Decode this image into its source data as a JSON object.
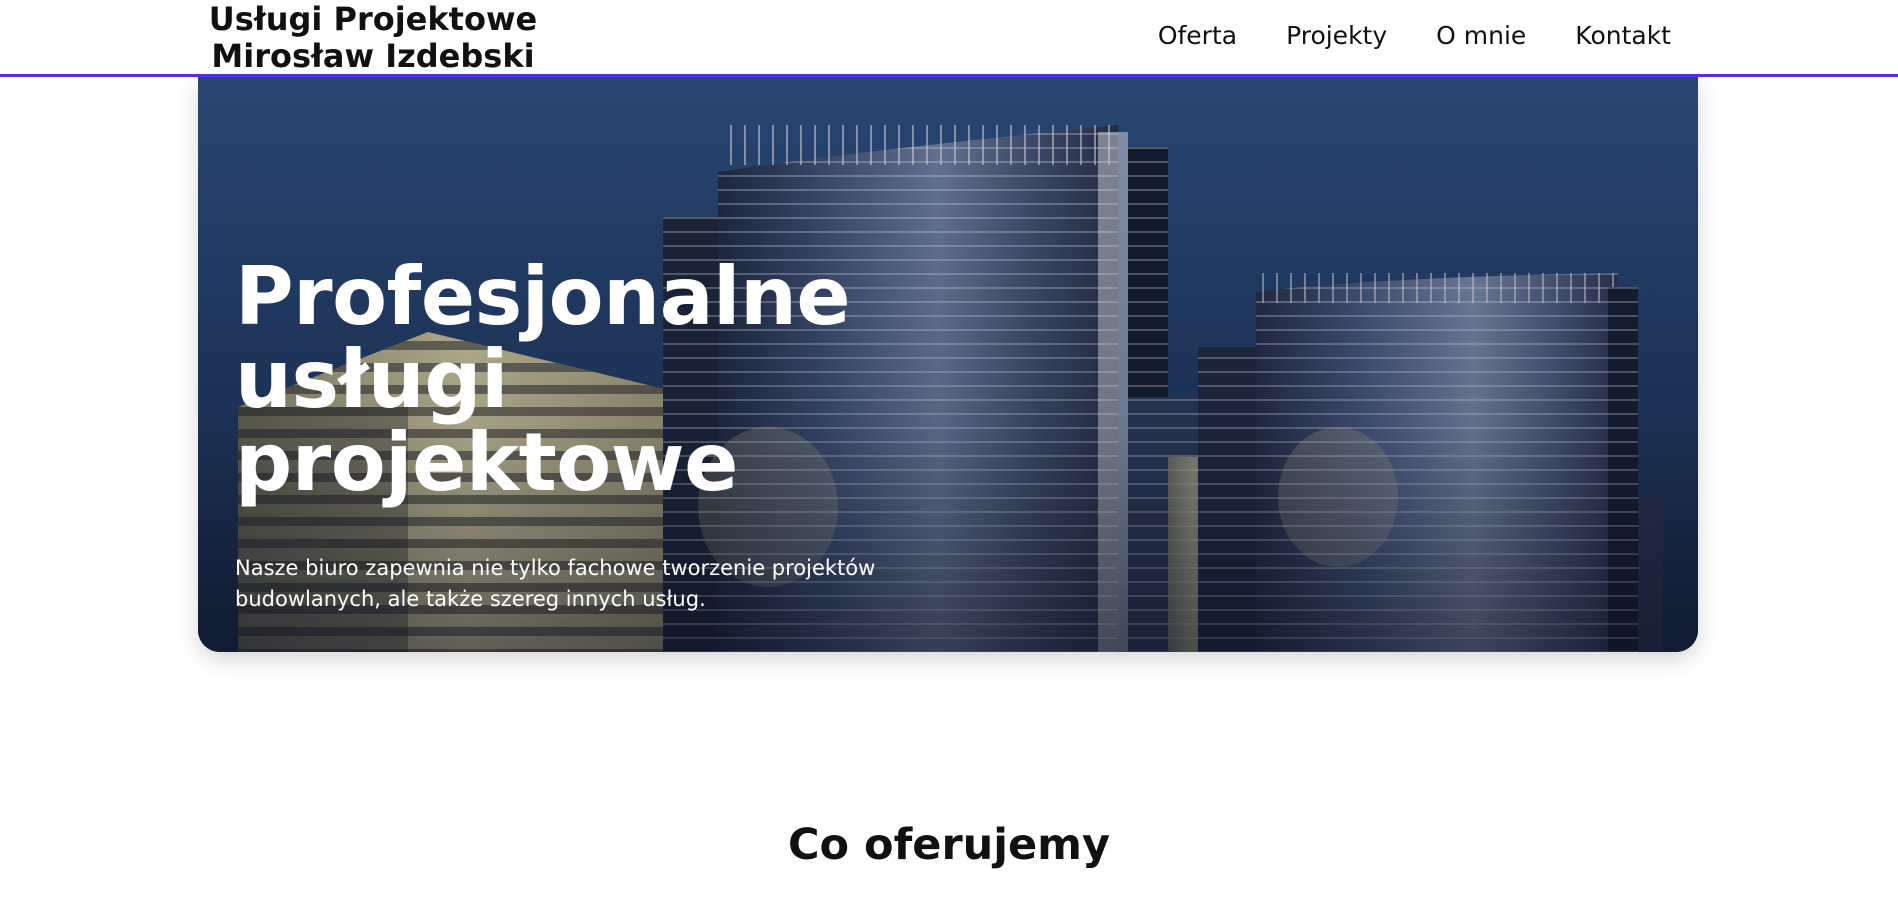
{
  "header": {
    "brand_line1": "Usługi Projektowe",
    "brand_line2": "Mirosław Izdebski",
    "accent_color": "#5b2be0",
    "nav": [
      {
        "label": "Oferta"
      },
      {
        "label": "Projekty"
      },
      {
        "label": "O mnie"
      },
      {
        "label": "Kontakt"
      }
    ]
  },
  "hero": {
    "title": "Profesjonalne usługi projektowe",
    "text": "Nasze biuro zapewnia nie tylko fachowe tworzenie projektów budowlanych, ale także szereg innych usług.",
    "image": "office-towers-photo"
  },
  "offer_section": {
    "title": "Co oferujemy"
  }
}
